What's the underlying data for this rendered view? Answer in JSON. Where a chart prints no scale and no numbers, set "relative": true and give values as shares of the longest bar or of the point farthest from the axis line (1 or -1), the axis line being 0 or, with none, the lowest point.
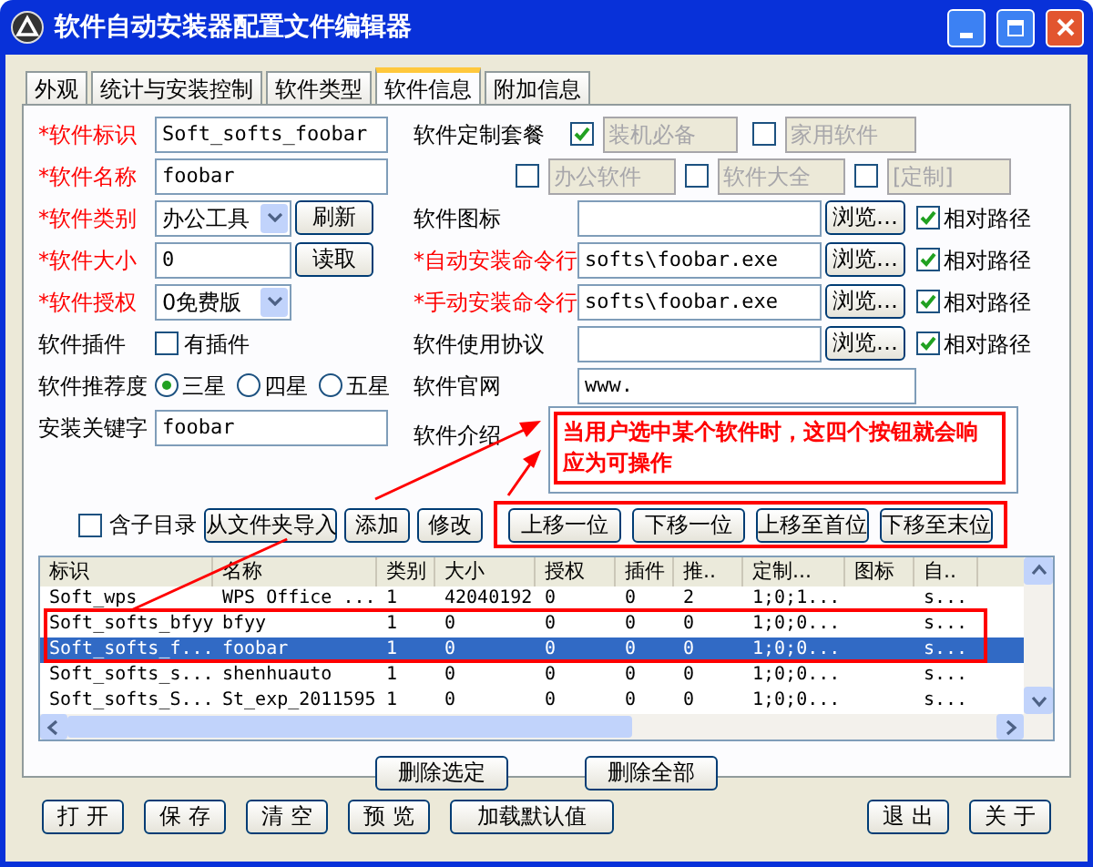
{
  "window": {
    "title": "软件自动安装器配置文件编辑器"
  },
  "tabs": [
    {
      "label": "外观",
      "selected": false
    },
    {
      "label": "统计与安装控制",
      "selected": false
    },
    {
      "label": "软件类型",
      "selected": false
    },
    {
      "label": "软件信息",
      "selected": true
    },
    {
      "label": "附加信息",
      "selected": false
    }
  ],
  "left_fields": [
    {
      "kind": "text",
      "label": "*软件标识",
      "required": true,
      "value": "Soft_softs_foobar"
    },
    {
      "kind": "text",
      "label": "*软件名称",
      "required": true,
      "value": "foobar"
    },
    {
      "kind": "select",
      "label": "*软件类别",
      "required": true,
      "value": "办公工具",
      "button": "刷新"
    },
    {
      "kind": "text",
      "label": "*软件大小",
      "required": true,
      "value": "0",
      "button": "读取"
    },
    {
      "kind": "select",
      "label": "*软件授权",
      "required": true,
      "value": "0免费版"
    },
    {
      "kind": "checkbox",
      "label": "软件插件",
      "required": false,
      "option": "有插件",
      "checked": false
    },
    {
      "kind": "radio",
      "label": "软件推荐度",
      "required": false,
      "options": [
        {
          "label": "三星",
          "selected": true
        },
        {
          "label": "四星",
          "selected": false
        },
        {
          "label": "五星",
          "selected": false
        }
      ]
    },
    {
      "kind": "text",
      "label": "安装关键字",
      "required": false,
      "value": "foobar"
    }
  ],
  "package": {
    "label": "软件定制套餐",
    "options": [
      {
        "label": "装机必备",
        "checked": true
      },
      {
        "label": "家用软件",
        "checked": false
      },
      {
        "label": "办公软件",
        "checked": false
      },
      {
        "label": "软件大全",
        "checked": false
      },
      {
        "label": "[定制]",
        "checked": false
      }
    ]
  },
  "path_fields": [
    {
      "label": "软件图标",
      "required": false,
      "button": "浏览…",
      "relative_label": "相对路径",
      "relative": true
    },
    {
      "label": "*自动安装命令行",
      "required": true,
      "value": "softs\\foobar.exe",
      "button": "浏览…",
      "relative_label": "相对路径",
      "relative": true
    },
    {
      "label": "*手动安装命令行",
      "required": true,
      "value": "softs\\foobar.exe",
      "button": "浏览…",
      "relative_label": "相对路径",
      "relative": true
    },
    {
      "label": "软件使用协议",
      "required": false,
      "button": "浏览…",
      "relative_label": "相对路径",
      "relative": true
    }
  ],
  "website": {
    "label": "软件官网",
    "value": "www."
  },
  "intro": {
    "label": "软件介绍"
  },
  "annotation": {
    "text": "当用户选中某个软件时，这四个按钮就会响应为可操作"
  },
  "list_toolbar": {
    "include_subdirs": {
      "label": "含子目录",
      "checked": false
    },
    "buttons": [
      "从文件夹导入",
      "添加",
      "修改"
    ]
  },
  "move_buttons": [
    "上移一位",
    "下移一位",
    "上移至首位",
    "下移至末位"
  ],
  "table": {
    "columns": [
      "标识",
      "名称",
      "类别",
      "大小",
      "授权",
      "插件",
      "推..",
      "定制...",
      "图标",
      "自.."
    ],
    "rows": [
      {
        "selected": false,
        "cells": [
          "Soft_wps",
          "WPS Office ...",
          "1",
          "42040192",
          "0",
          "0",
          "2",
          "1;0;1...",
          null,
          "s..."
        ]
      },
      {
        "selected": false,
        "cells": [
          "Soft_softs_bfyy",
          "bfyy",
          "1",
          "0",
          "0",
          "0",
          "0",
          "1;0;0...",
          null,
          "s..."
        ]
      },
      {
        "selected": true,
        "cells": [
          "Soft_softs_f...",
          "foobar",
          "1",
          "0",
          "0",
          "0",
          "0",
          "1;0;0...",
          null,
          "s..."
        ]
      },
      {
        "selected": false,
        "cells": [
          "Soft_softs_s...",
          "shenhuauto",
          "1",
          "0",
          "0",
          "0",
          "0",
          "1;0;0...",
          null,
          "s..."
        ]
      },
      {
        "selected": false,
        "cells": [
          "Soft_softs_S...",
          "St_exp_2011595",
          "1",
          "0",
          "0",
          "0",
          "0",
          "1;0;0...",
          null,
          "s..."
        ]
      }
    ]
  },
  "list_buttons": [
    "删除选定",
    "删除全部"
  ],
  "footer_left": [
    "打 开",
    "保 存",
    "清 空",
    "预 览",
    "加载默认值"
  ],
  "footer_right": [
    "退 出",
    "关 于"
  ]
}
